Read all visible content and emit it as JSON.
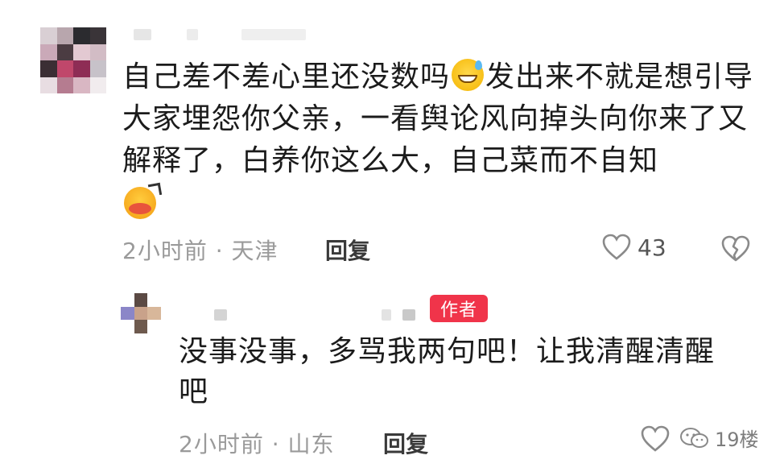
{
  "comment": {
    "text_part1": "自己差不差心里还没数吗",
    "text_part2": "发出来不就是想引导大家埋怨你父亲，一看舆论风向掉头向你来了又解释了，白养你这么大，自己菜而不自知",
    "emoji_1": "sweat-smile-icon",
    "emoji_2": "angry-face-icon",
    "time_location": "2小时前 · 天津",
    "reply_label": "回复",
    "like_count": "43"
  },
  "reply": {
    "badge": "作者",
    "text": "没事没事，多骂我两句吧！让我清醒清醒吧",
    "time_location": "2小时前 · 山东",
    "reply_label": "回复"
  },
  "watermark": {
    "text": "19楼"
  },
  "colors": {
    "badge_bg": "#f0344a",
    "meta_text": "#9a9a9a",
    "body_text": "#1b1b1b"
  }
}
